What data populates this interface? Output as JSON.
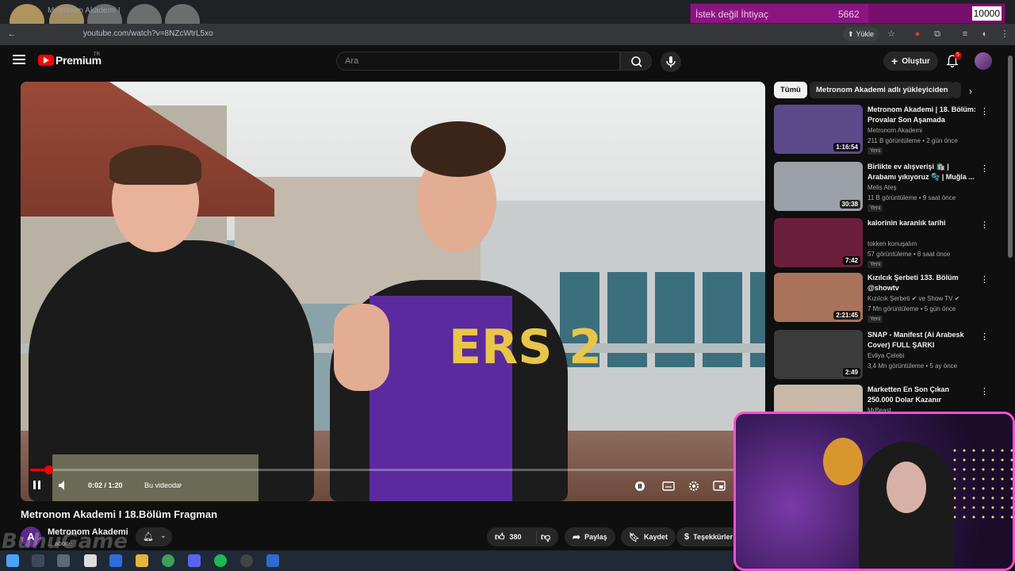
{
  "browser": {
    "tab_title": "Metronom Akademi I",
    "url": "youtube.com/watch?v=8NZcWtrL5xo",
    "upload_label": "Yükle"
  },
  "wish_bar": {
    "label": "İstek değil İhtiyaç",
    "current": "5662",
    "goal": "10000",
    "progress": 0.566,
    "color": "#7a0e6e"
  },
  "header": {
    "brand": "Premium",
    "region": "TR",
    "search_placeholder": "Ara",
    "create_label": "Oluştur",
    "notification_count": "5"
  },
  "player": {
    "time": "0:02 / 1:20",
    "chapter": "Bu videoda",
    "progress": 0.025,
    "jersey_text": "ERS 2"
  },
  "video": {
    "title": "Metronom Akademi I 18.Bölüm Fragman",
    "channel": "Metronom Akademi",
    "channel_initial": "A",
    "subs": "... abone",
    "likes": "380",
    "share_label": "Paylaş",
    "save_label": "Kaydet",
    "thanks_label": "Teşekkürler"
  },
  "sidebar": {
    "chips": [
      "Tümü",
      "Metronom Akademi adlı yükleyiciden"
    ],
    "recommendations": [
      {
        "title": "Metronom Akademi | 18. Bölüm: Provalar Son Aşamada",
        "channel": "Metronom Akademi",
        "meta": "211 B görüntüleme • 2 gün önce",
        "badge": "Yeni",
        "duration": "1:16:54",
        "thumb": "#5a4a8a"
      },
      {
        "title": "Birlikte ev alışverişi 🛍️ | Arabamı yıkıyoruz 🫧 | Muğla ...",
        "channel": "Melis Ateş",
        "meta": "11 B görüntüleme • 9 saat önce",
        "badge": "Yeni",
        "duration": "30:38",
        "thumb": "#9aa0a6"
      },
      {
        "title": "kalorinin karanlık tarihi",
        "channel": "tokken konuşalım",
        "meta": "57 görüntüleme • 8 saat önce",
        "badge": "Yeni",
        "duration": "7:42",
        "thumb": "#6b1f3a"
      },
      {
        "title": "Kızılcık Şerbeti 133. Bölüm @showtv",
        "channel": "Kızılcık Şerbeti ✔ ve Show TV ✔",
        "meta": "7 Mn görüntüleme • 5 gün önce",
        "badge": "Yeni",
        "duration": "2:21:45",
        "thumb": "#a8735a"
      },
      {
        "title": "SNAP - Manifest (Ai Arabesk Cover) FULL ŞARKI",
        "channel": "Evliya Çelebi",
        "meta": "3,4 Mn görüntüleme • 5 ay önce",
        "badge": "",
        "duration": "2:49",
        "thumb": "#3b3b3b"
      },
      {
        "title": "Marketten En Son Çıkan 250.000 Dolar Kazanır",
        "channel": "MrBeast",
        "meta": "",
        "badge": "",
        "duration": "",
        "thumb": "#c8b8a8"
      }
    ]
  },
  "watermark": "BuhuGame"
}
